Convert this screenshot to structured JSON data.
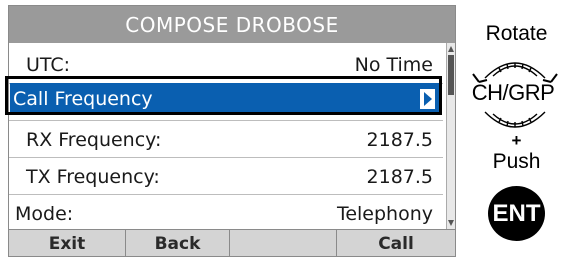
{
  "screen": {
    "title": "COMPOSE DROBOSE",
    "rows": [
      {
        "label": "UTC:",
        "value": "No Time"
      },
      {
        "label": "Call Frequency",
        "value": ""
      },
      {
        "label": "RX Frequency:",
        "value": "2187.5"
      },
      {
        "label": "TX Frequency:",
        "value": "2187.5"
      },
      {
        "label": "Mode:",
        "value": "Telephony"
      }
    ],
    "softkeys": [
      "Exit",
      "Back",
      "",
      "Call"
    ]
  },
  "hints": {
    "rotate": "Rotate",
    "knob_label": "CH/GRP",
    "plus": "+",
    "push": "Push",
    "ent": "ENT"
  },
  "colors": {
    "title_bar": "#9a9a9a",
    "selection": "#0a5fb0",
    "softkey_bg": "#d4d4d4"
  },
  "icons": [
    "chevron-right-icon",
    "rotary-knob-icon",
    "scroll-up-icon",
    "scroll-down-icon"
  ]
}
